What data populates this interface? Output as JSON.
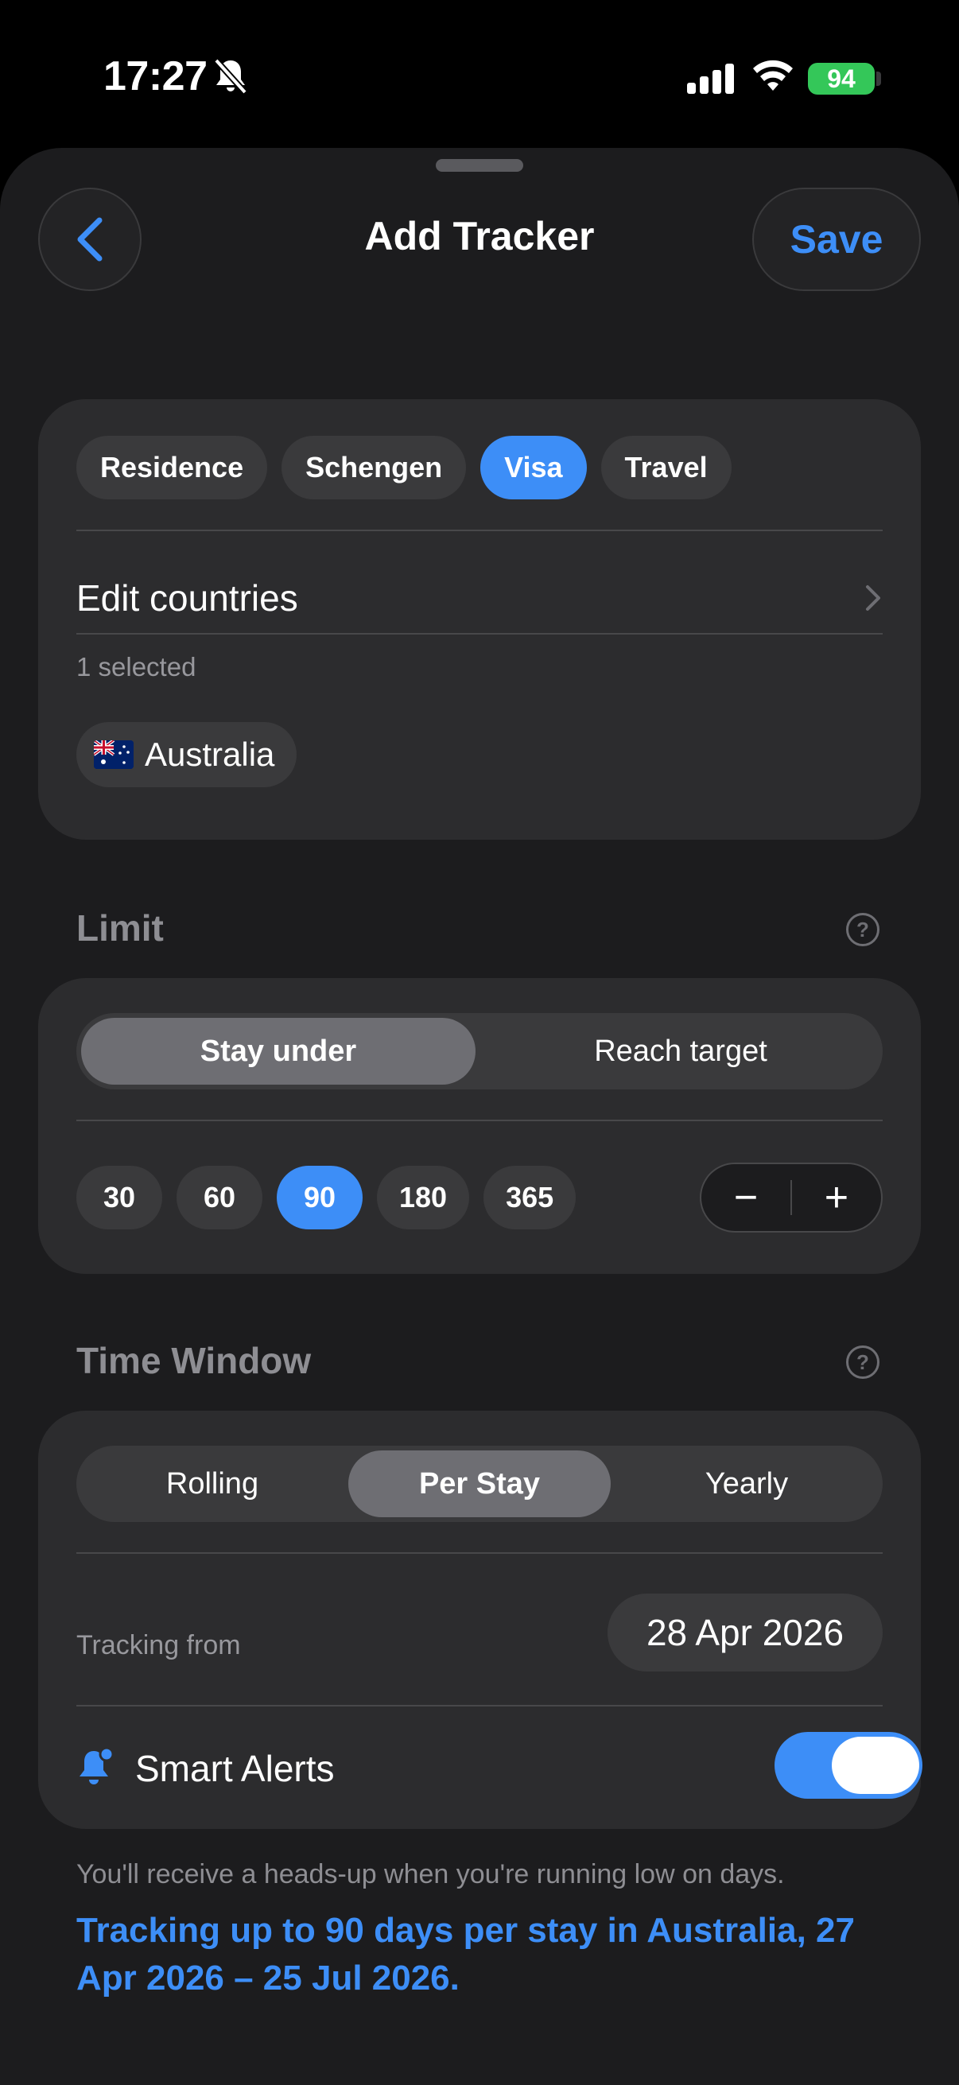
{
  "status_bar": {
    "time": "17:27",
    "battery": "94",
    "icons": [
      "bell-slash-icon",
      "cellular-signal-icon",
      "wifi-icon",
      "battery-charging-icon"
    ]
  },
  "header": {
    "title": "Add Tracker",
    "save_label": "Save",
    "back_icon": "chevron-left-icon"
  },
  "categories": {
    "items": [
      "Residence",
      "Schengen",
      "Visa",
      "Travel"
    ],
    "selected": "Visa"
  },
  "countries": {
    "edit_label": "Edit countries",
    "selected_count": "1 selected",
    "items": [
      {
        "name": "Australia",
        "flag": "australia-flag"
      }
    ]
  },
  "limit": {
    "title": "Limit",
    "modes": [
      "Stay under",
      "Reach target"
    ],
    "selected_mode": "Stay under",
    "presets": [
      "30",
      "60",
      "90",
      "180",
      "365"
    ],
    "selected_preset": "90",
    "stepper": {
      "minus": "−",
      "plus": "+"
    }
  },
  "time_window": {
    "title": "Time Window",
    "modes": [
      "Rolling",
      "Per Stay",
      "Yearly"
    ],
    "selected_mode": "Per Stay",
    "tracking_from_label": "Tracking from",
    "tracking_from_date": "28 Apr 2026",
    "smart_alerts_label": "Smart Alerts",
    "smart_alerts_on": true
  },
  "footer": {
    "note": "You'll receive a heads-up when you're running low on days.",
    "summary": "Tracking up to 90 days per stay in Australia, 27 Apr 2026 – 25 Jul 2026."
  },
  "colors": {
    "accent": "#3d8ef7",
    "sheet_bg": "#1c1c1e",
    "card_bg": "#2c2c2e",
    "battery_green": "#34c759"
  }
}
